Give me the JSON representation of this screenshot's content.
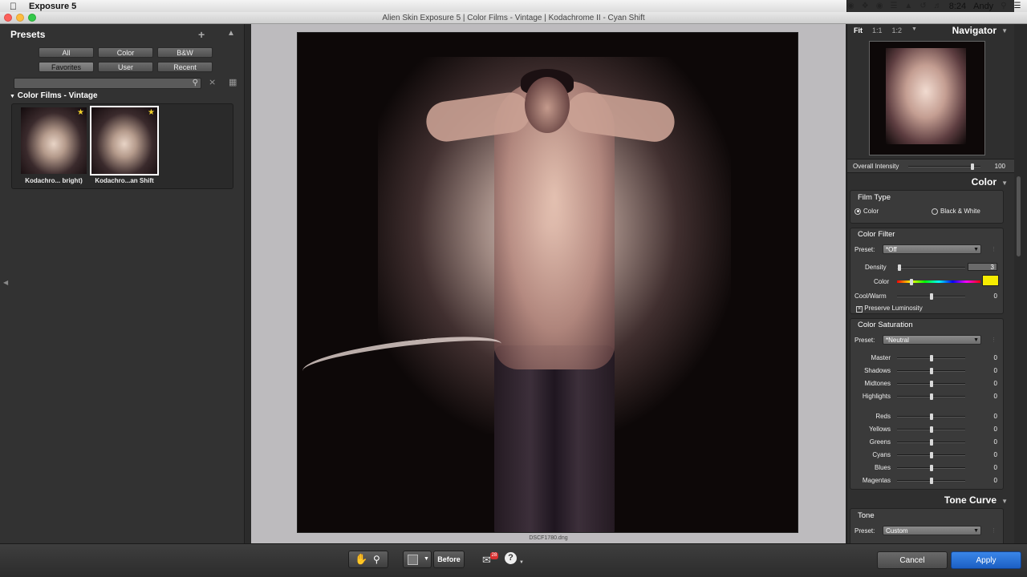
{
  "menubar": {
    "app_name": "Exposure 5",
    "clock": "Tue 8:24 PM",
    "user": "Andy",
    "icons": [
      "finder-icon",
      "dropbox-icon",
      "eye-icon",
      "wifi-icon",
      "upload-icon",
      "time-machine-icon",
      "volume-icon",
      "search-icon",
      "list-icon"
    ]
  },
  "window": {
    "title": "Alien Skin Exposure 5 | Color Films - Vintage | Kodachrome II - Cyan Shift"
  },
  "presets": {
    "title": "Presets",
    "filters": [
      "All",
      "Color",
      "B&W",
      "Favorites",
      "User",
      "Recent"
    ],
    "active_filter": "Favorites",
    "search_placeholder": "",
    "group_title": "Color Films - Vintage",
    "items": [
      {
        "label": "Kodachro... bright)",
        "favorite": true,
        "selected": false
      },
      {
        "label": "Kodachro...an Shift",
        "favorite": true,
        "selected": true
      }
    ]
  },
  "canvas": {
    "filename": "DSCF1780.dng"
  },
  "navigator": {
    "tabs": [
      "Fit",
      "1:1",
      "1:2"
    ],
    "active_tab": "Fit",
    "title": "Navigator",
    "intensity_label": "Overall Intensity",
    "intensity_value": "100"
  },
  "color_section": {
    "title": "Color",
    "film_type": {
      "title": "Film Type",
      "options": [
        "Color",
        "Black & White"
      ],
      "selected": "Color"
    },
    "color_filter": {
      "title": "Color Filter",
      "preset_label": "Preset:",
      "preset_value": "*Off",
      "density_label": "Density",
      "density_value": "3",
      "color_label": "Color",
      "swatch_color": "#f6ec00",
      "coolwarm_label": "Cool/Warm",
      "coolwarm_value": "0",
      "preserve_label": "Preserve Luminosity",
      "preserve_checked": true
    },
    "color_saturation": {
      "title": "Color Saturation",
      "preset_label": "Preset:",
      "preset_value": "*Neutral",
      "sliders": [
        {
          "label": "Master",
          "value": "0"
        },
        {
          "label": "Shadows",
          "value": "0"
        },
        {
          "label": "Midtones",
          "value": "0"
        },
        {
          "label": "Highlights",
          "value": "0"
        },
        {
          "label": "Reds",
          "value": "0"
        },
        {
          "label": "Yellows",
          "value": "0"
        },
        {
          "label": "Greens",
          "value": "0"
        },
        {
          "label": "Cyans",
          "value": "0"
        },
        {
          "label": "Blues",
          "value": "0"
        },
        {
          "label": "Magentas",
          "value": "0"
        }
      ]
    }
  },
  "tone_curve": {
    "title": "Tone Curve",
    "tone_title": "Tone",
    "preset_label": "Preset:",
    "preset_value": "Custom"
  },
  "bottom": {
    "before_label": "Before",
    "badge_count": "28",
    "cancel_label": "Cancel",
    "apply_label": "Apply",
    "accent_color": "#2a75dc"
  }
}
